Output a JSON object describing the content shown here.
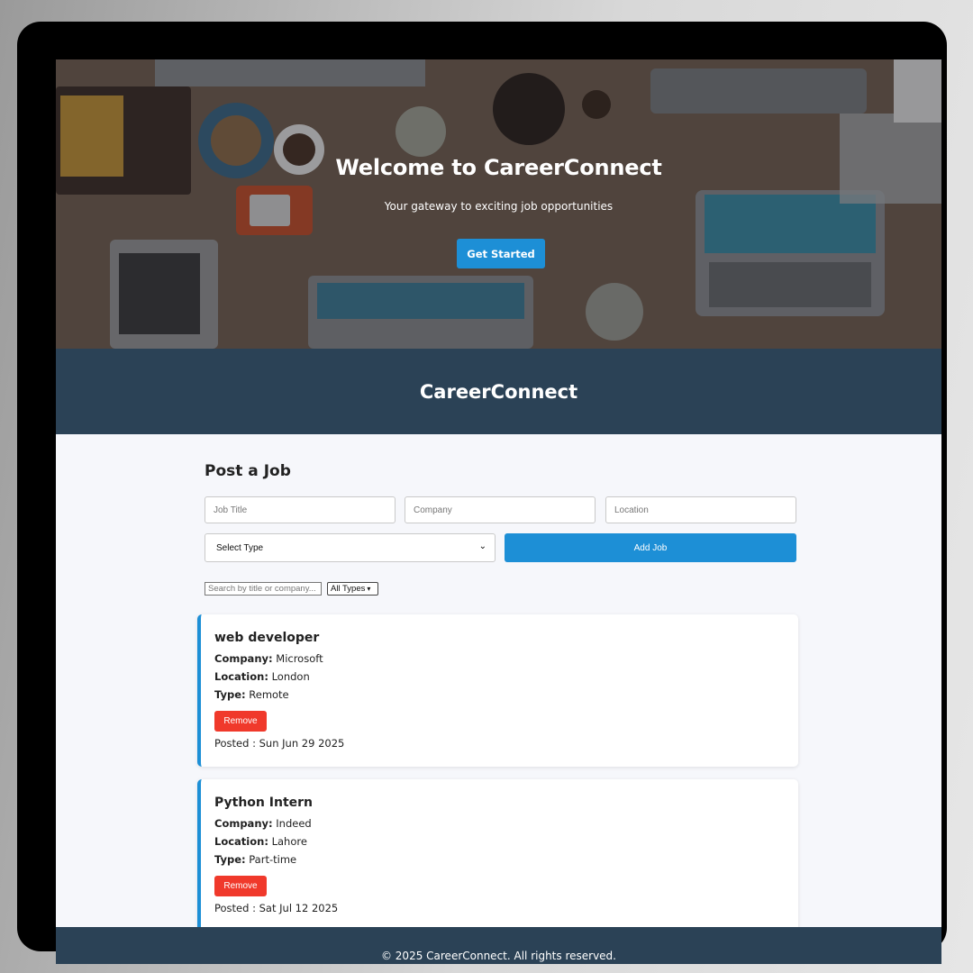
{
  "hero": {
    "title": "Welcome to CareerConnect",
    "subtitle": "Your gateway to exciting job opportunities",
    "cta_label": "Get Started"
  },
  "brand": {
    "title": "CareerConnect"
  },
  "post_job": {
    "heading": "Post a Job",
    "title_placeholder": "Job Title",
    "company_placeholder": "Company",
    "location_placeholder": "Location",
    "type_select_value": "Select Type",
    "add_label": "Add Job"
  },
  "filters": {
    "search_placeholder": "Search by title or company...",
    "type_value": "All Types"
  },
  "labels": {
    "company": "Company:",
    "location": "Location:",
    "type": "Type:"
  },
  "jobs": [
    {
      "title": "web developer",
      "company": "Microsoft",
      "location": "London",
      "type": "Remote",
      "remove_label": "Remove",
      "posted": "Posted : Sun Jun 29 2025"
    },
    {
      "title": "Python Intern",
      "company": "Indeed",
      "location": "Lahore",
      "type": "Part-time",
      "remove_label": "Remove",
      "posted": "Posted : Sat Jul 12 2025"
    }
  ],
  "footer": {
    "text": "© 2025 CareerConnect. All rights reserved."
  },
  "colors": {
    "accent": "#1d8fd6",
    "navy": "#2b4256",
    "danger": "#f0392b"
  }
}
